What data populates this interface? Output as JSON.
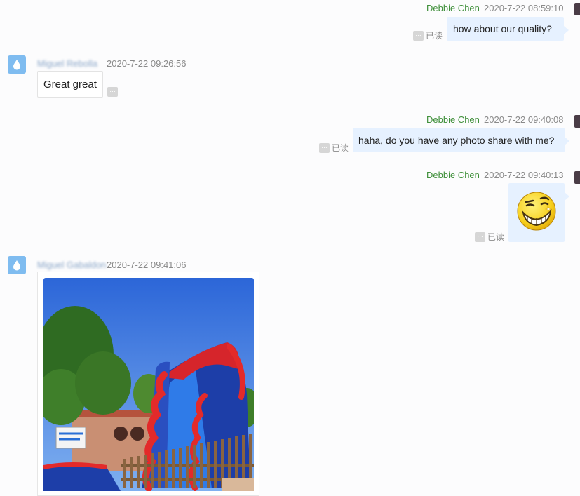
{
  "messages": [
    {
      "sender": "Debbie Chen",
      "time": "2020-7-22 08:59:10",
      "text": "how about our quality?",
      "status": "已读"
    },
    {
      "sender": "Miguel Rebolla",
      "time": "2020-7-22 09:26:56",
      "text": "Great great"
    },
    {
      "sender": "Debbie Chen",
      "time": "2020-7-22 09:40:08",
      "text": "haha, do you have any photo share with me?",
      "status": "已读"
    },
    {
      "sender": "Debbie Chen",
      "time": "2020-7-22 09:40:13",
      "emoji": "smirk-grin-emoji",
      "status": "已读"
    },
    {
      "sender": "Miguel Gabaldon",
      "time": "2020-7-22 09:41:06",
      "image": "inflatable-water-slide-photo"
    }
  ],
  "icons": {
    "more": "more-options-icon",
    "avatar_in": "water-drop-avatar-icon"
  },
  "colors": {
    "sender_green": "#3f8f3a",
    "bubble_blue": "#e6f1ff",
    "avatar_blue": "#7fbcf0"
  },
  "more_glyph": "…"
}
